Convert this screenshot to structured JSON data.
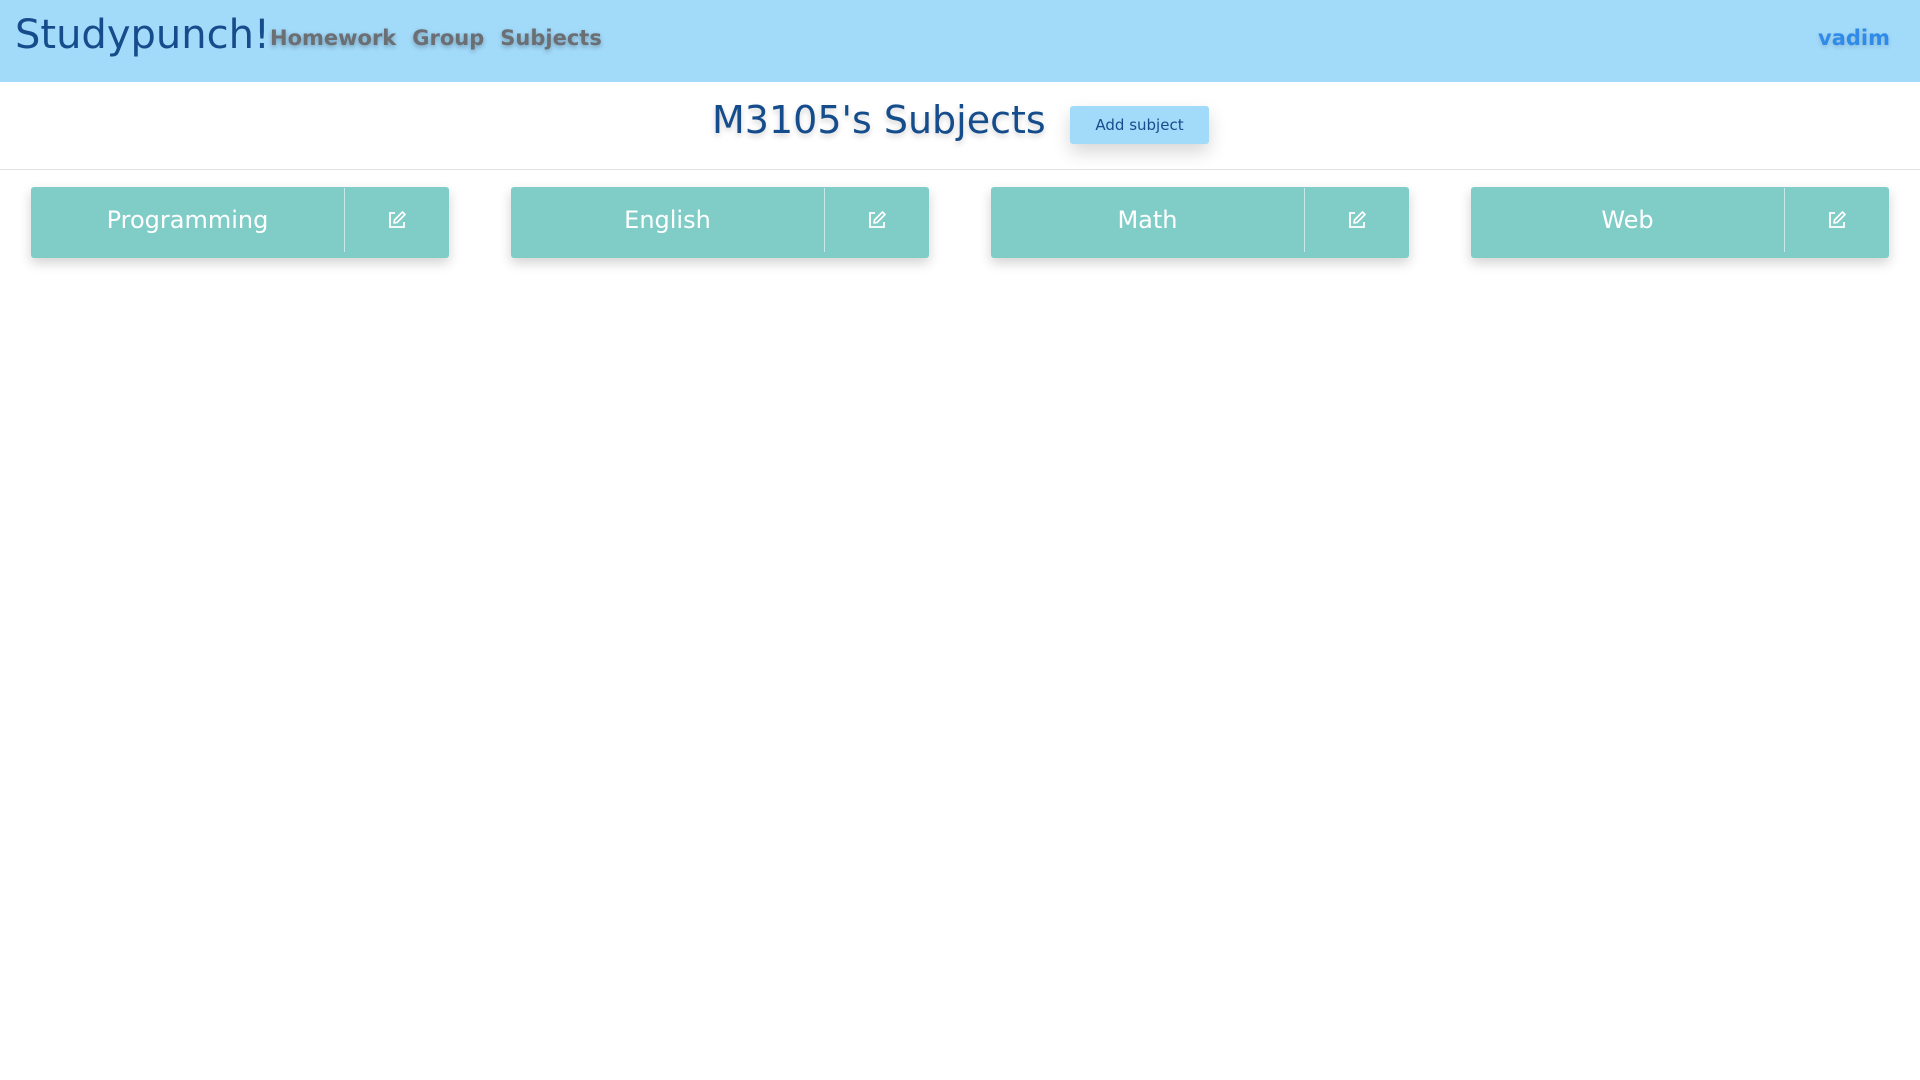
{
  "navbar": {
    "brand": "Studypunch!",
    "links": [
      {
        "label": "Homework"
      },
      {
        "label": "Group"
      },
      {
        "label": "Subjects"
      }
    ],
    "user": "vadim"
  },
  "page": {
    "title": "M3105's Subjects",
    "add_button_label": "Add subject"
  },
  "subjects": [
    {
      "name": "Programming",
      "action_icon": "edit-icon"
    },
    {
      "name": "English",
      "action_icon": "edit-icon"
    },
    {
      "name": "Math",
      "action_icon": "edit-icon"
    },
    {
      "name": "Web",
      "action_icon": "edit-icon"
    }
  ],
  "colors": {
    "navbar_bg": "#a2dafa",
    "brand_text": "#154c8c",
    "nav_link_text": "#6b6f74",
    "user_link": "#2f8bea",
    "card_bg": "#80cdc8",
    "card_text": "#ffffff"
  }
}
